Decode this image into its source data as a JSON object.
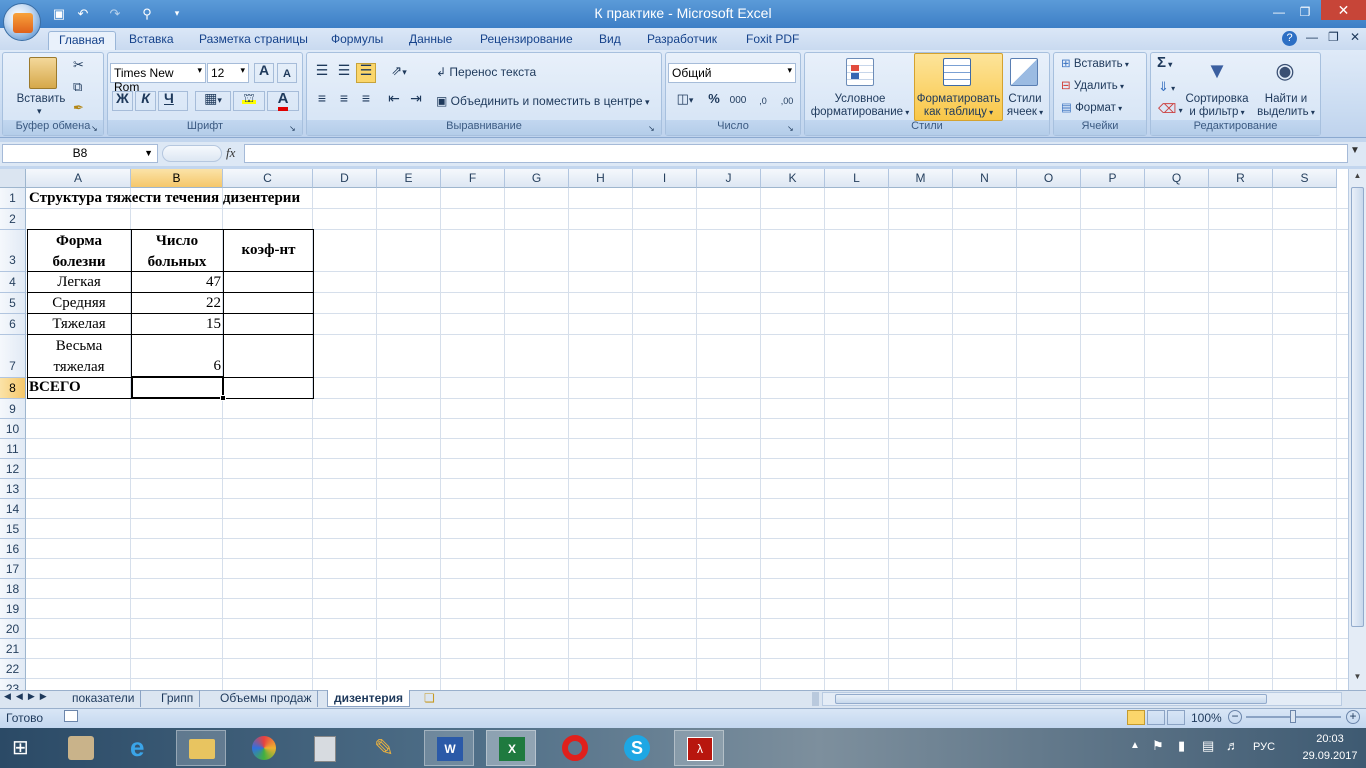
{
  "window": {
    "title": "К практике - Microsoft Excel"
  },
  "tabs": [
    "Главная",
    "Вставка",
    "Разметка страницы",
    "Формулы",
    "Данные",
    "Рецензирование",
    "Вид",
    "Разработчик",
    "Foxit PDF"
  ],
  "ribbon": {
    "clipboard": {
      "paste": "Вставить",
      "label": "Буфер обмена"
    },
    "font": {
      "name": "Times New Rom",
      "size": "12",
      "bold": "Ж",
      "italic": "К",
      "underline": "Ч",
      "grow": "A",
      "shrink": "A",
      "color_a": "A",
      "label": "Шрифт"
    },
    "align": {
      "wrap": "Перенос текста",
      "merge": "Объединить и поместить в центре",
      "label": "Выравнивание"
    },
    "number": {
      "format": "Общий",
      "percent": "%",
      "thousands": "000",
      "inc": ",0",
      "dec": ",00",
      "label": "Число"
    },
    "styles": {
      "cond1": "Условное",
      "cond2": "форматирование",
      "fmt1": "Форматировать",
      "fmt2": "как таблицу",
      "cell1": "Стили",
      "cell2": "ячеек",
      "label": "Стили"
    },
    "cells": {
      "insert": "Вставить",
      "delete": "Удалить",
      "format": "Формат",
      "label": "Ячейки"
    },
    "edit": {
      "sum": "Σ",
      "sort1": "Сортировка",
      "sort2": "и фильтр",
      "find1": "Найти и",
      "find2": "выделить",
      "label": "Редактирование"
    }
  },
  "formula_bar": {
    "name_box": "B8",
    "fx": "fx",
    "value": ""
  },
  "columns": [
    "A",
    "B",
    "C",
    "D",
    "E",
    "F",
    "G",
    "H",
    "I",
    "J",
    "K",
    "L",
    "M",
    "N",
    "O",
    "P",
    "Q",
    "R",
    "S"
  ],
  "rows": [
    "1",
    "2",
    "3",
    "4",
    "5",
    "6",
    "7",
    "8",
    "9",
    "10",
    "11",
    "12",
    "13",
    "14",
    "15",
    "16",
    "17",
    "18",
    "19",
    "20",
    "21",
    "22",
    "23"
  ],
  "cells": {
    "a1": "Структура тяжести течения дизентерии",
    "a3_1": "Форма",
    "a3_2": "болезни",
    "b3_1": "Число",
    "b3_2": "больных",
    "c3": "коэф-нт",
    "a4": "Легкая",
    "b4": "47",
    "a5": "Средняя",
    "b5": "22",
    "a6": "Тяжелая",
    "b6": "15",
    "a7_1": "Весьма",
    "a7_2": "тяжелая",
    "b7": "6",
    "a8": "ВСЕГО"
  },
  "sheets": [
    "показатели",
    "Грипп",
    "Объемы продаж",
    "дизентерия"
  ],
  "active_sheet": "дизентерия",
  "status": {
    "ready": "Готово",
    "zoom": "100%"
  },
  "taskbar": {
    "lang": "РУС",
    "time": "20:03",
    "date": "29.09.2017"
  }
}
